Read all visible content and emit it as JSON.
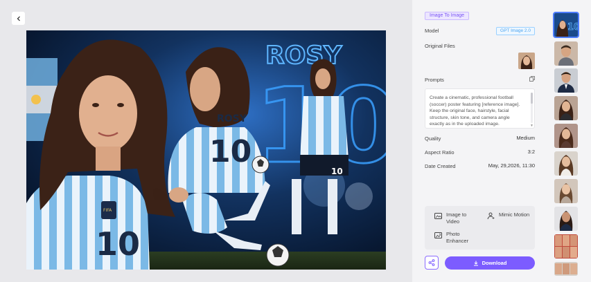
{
  "header": {
    "back_icon": "chevron-left-icon"
  },
  "main_image": {
    "alt": "Football poster",
    "jersey_name": "ROSY",
    "jersey_number": "10",
    "big_number": "10",
    "badge_text": "FIFA",
    "colors": {
      "sky": "#0b1e3c",
      "glow": "#3aa0ff",
      "stripe": "#75b8e8"
    }
  },
  "panel": {
    "mode_tag": "Image To Image",
    "model_label": "Model",
    "model_value": "GPT Image 2.0",
    "original_files_label": "Original Files",
    "prompts_label": "Prompts",
    "prompt_text": "Create a cinematic, professional football (soccer) poster featuring [reference image]. Keep the original face, hairstyle, facial structure, skin tone, and camera angle exactly as in the uploaded image.",
    "quality_label": "Quality",
    "quality_value": "Medium",
    "aspect_label": "Aspect Ratio",
    "aspect_value": "3:2",
    "date_label": "Date Created",
    "date_value": "May, 29,2026, 11:30",
    "tools": {
      "image_to_video": "Image to Video",
      "mimic_motion": "Mimic Motion",
      "photo_enhancer": "Photo Enhancer"
    },
    "download_label": "Download",
    "accent": "#7c5cff"
  },
  "history": {
    "items": [
      {
        "kind": "poster",
        "active": true
      },
      {
        "kind": "man"
      },
      {
        "kind": "man-suit"
      },
      {
        "kind": "woman"
      },
      {
        "kind": "woman"
      },
      {
        "kind": "woman"
      },
      {
        "kind": "woman"
      },
      {
        "kind": "woman-dark"
      },
      {
        "kind": "grid"
      },
      {
        "kind": "grid"
      }
    ]
  }
}
